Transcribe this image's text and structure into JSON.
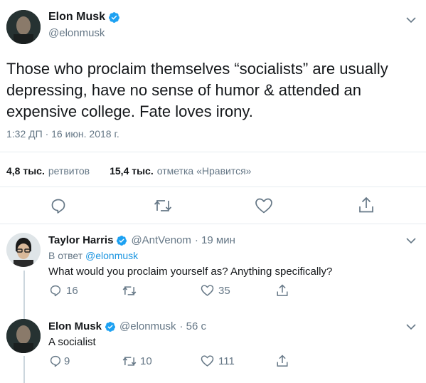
{
  "main_tweet": {
    "author_name": "Elon Musk",
    "handle": "@elonmusk",
    "text_line1": "Those who proclaim themselves “socialists” are usually",
    "text_line2": "depressing, have no sense of humor & attended an",
    "text_line3": "expensive college. Fate loves irony.",
    "timestamp": "1:32 ДП · 16 июн. 2018 г.",
    "retweets_count": "4,8 тыс.",
    "retweets_label": "ретвитов",
    "likes_count": "15,4 тыс.",
    "likes_label": "отметка «Нравится»"
  },
  "reply1": {
    "author_name": "Taylor Harris",
    "handle": "@AntVenom",
    "time": "· 19 мин",
    "reply_to_prefix": "В ответ",
    "reply_to_handle": "@elonmusk",
    "text": "What would you proclaim yourself as? Anything specifically?",
    "replies": "16",
    "retweets": "",
    "likes": "35"
  },
  "reply2": {
    "author_name": "Elon Musk",
    "handle": "@elonmusk",
    "time": "· 56 с",
    "text": "A socialist",
    "replies": "9",
    "retweets": "10",
    "likes": "111"
  },
  "colors": {
    "verified": "#1da1f2",
    "muted": "#657786",
    "link": "#1b95e0",
    "divider": "#e6ecf0"
  }
}
